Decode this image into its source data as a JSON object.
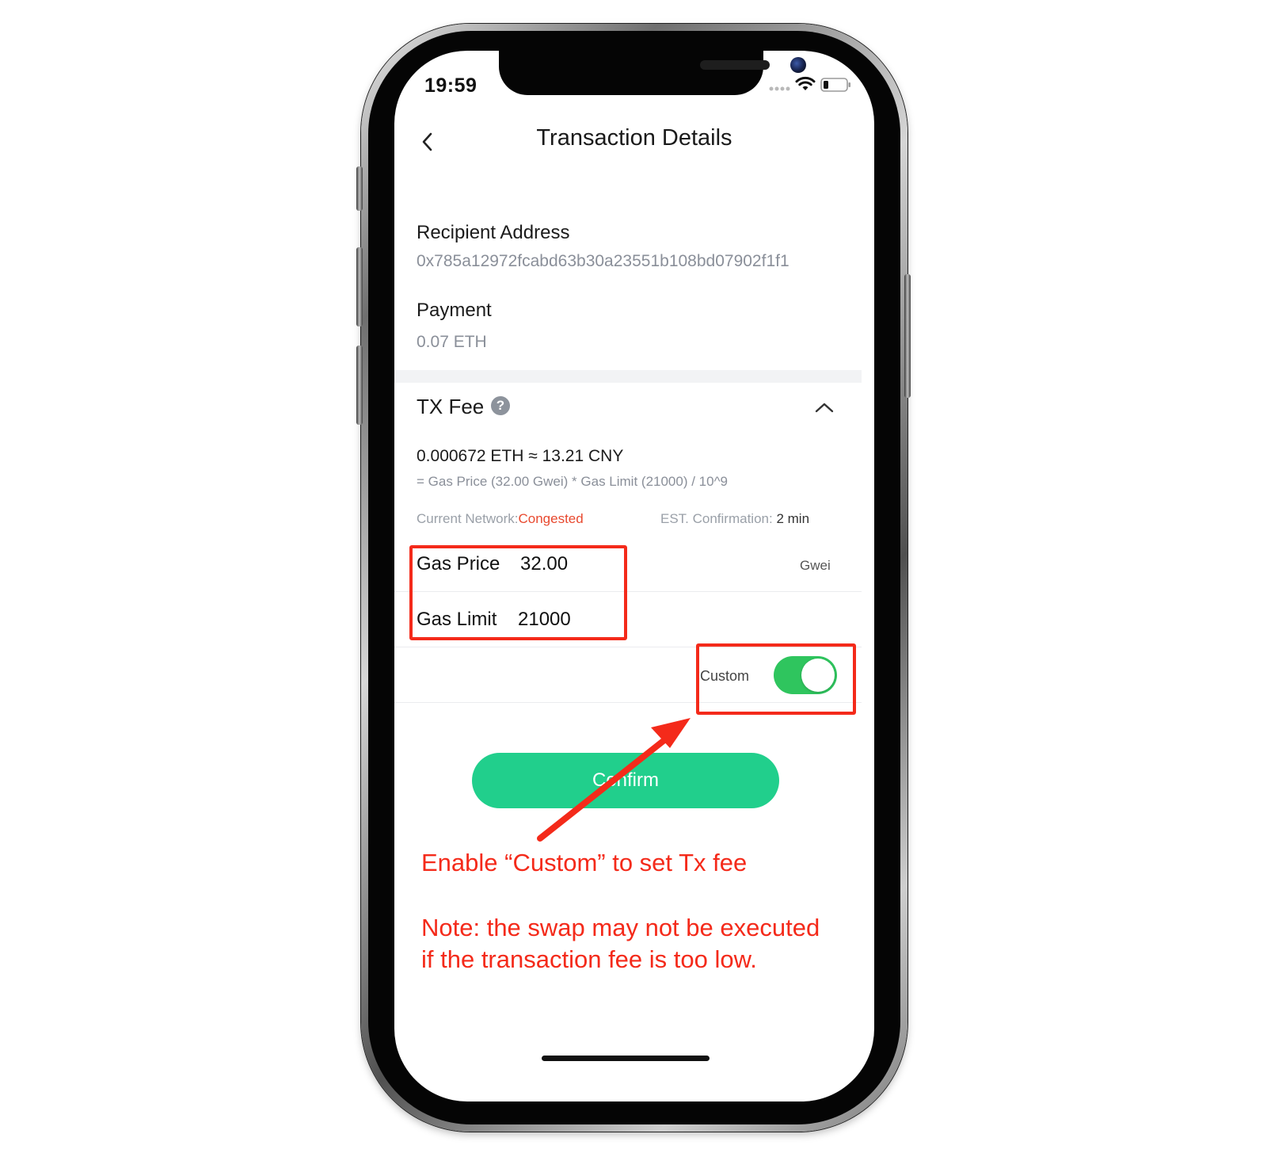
{
  "status_bar": {
    "time": "19:59"
  },
  "nav": {
    "back_icon": "chevron-left-icon",
    "title": "Transaction Details"
  },
  "recipient": {
    "label": "Recipient Address",
    "value": "0x785a12972fcabd63b30a23551b108bd07902f1f1"
  },
  "payment": {
    "label": "Payment",
    "value": "0.07 ETH"
  },
  "tx_fee": {
    "label": "TX Fee",
    "help_icon": "question-circle-icon",
    "help_glyph": "?",
    "collapse_icon": "chevron-up-icon",
    "amount": "0.000672 ETH ≈ 13.21 CNY",
    "formula": "= Gas Price (32.00 Gwei) * Gas Limit (21000)   / 10^9",
    "network_label": "Current Network:",
    "network_status": "Congested",
    "est_label": "EST. Confirmation:",
    "est_value": "2 min"
  },
  "gas": {
    "price_label": "Gas Price",
    "price_value": "32.00",
    "price_unit": "Gwei",
    "limit_label": "Gas Limit",
    "limit_value": "21000"
  },
  "custom": {
    "label": "Custom",
    "enabled": true
  },
  "confirm_button": {
    "label": "Confirm"
  },
  "annotations": {
    "instruction": "Enable “Custom” to set Tx fee",
    "note_line1": "Note: the swap may not be executed",
    "note_line2": "if the transaction fee is too low.",
    "color": "#f42a1a"
  },
  "colors": {
    "accent_green": "#21cf8c",
    "toggle_green": "#2fc55e",
    "congested_red": "#e8492f"
  }
}
